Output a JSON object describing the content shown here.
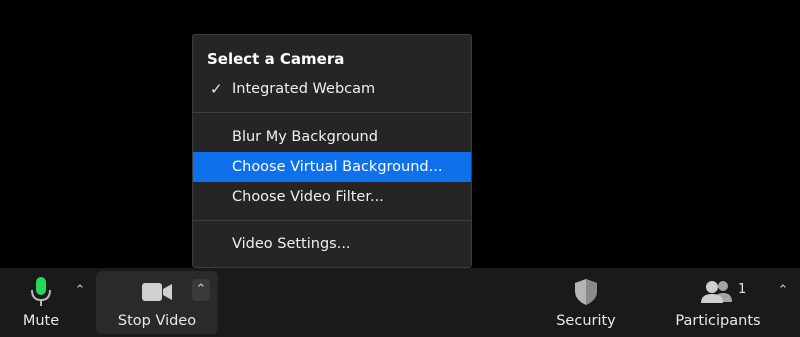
{
  "camera_menu": {
    "header": "Select a Camera",
    "items": [
      {
        "label": "Integrated Webcam",
        "checked": true
      },
      {
        "label": "Blur My Background"
      },
      {
        "label": "Choose Virtual Background...",
        "selected": true
      },
      {
        "label": "Choose Video Filter..."
      },
      {
        "label": "Video Settings..."
      }
    ],
    "check_glyph": "✓"
  },
  "toolbar": {
    "mute": {
      "label": "Mute",
      "icon": "microphone-icon"
    },
    "video": {
      "label": "Stop Video",
      "icon": "video-camera-icon"
    },
    "security": {
      "label": "Security",
      "icon": "shield-icon"
    },
    "participants": {
      "label": "Participants",
      "count": "1",
      "icon": "participants-icon"
    },
    "caret_glyph": "⌃"
  },
  "colors": {
    "highlight": "#0e71eb",
    "mic_green": "#23d959",
    "menu_bg": "#252525",
    "toolbar_bg": "#1a1a1a"
  }
}
